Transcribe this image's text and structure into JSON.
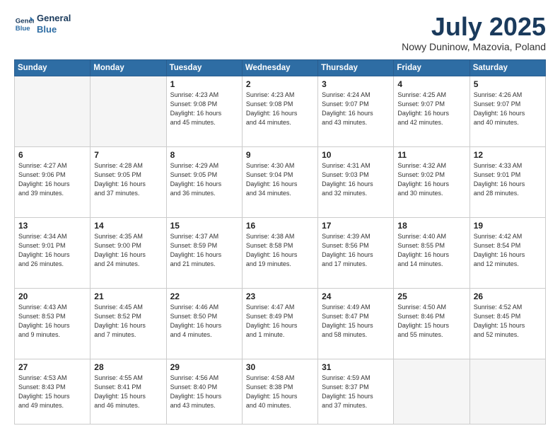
{
  "header": {
    "logo_line1": "General",
    "logo_line2": "Blue",
    "title": "July 2025",
    "subtitle": "Nowy Duninow, Mazovia, Poland"
  },
  "weekdays": [
    "Sunday",
    "Monday",
    "Tuesday",
    "Wednesday",
    "Thursday",
    "Friday",
    "Saturday"
  ],
  "weeks": [
    [
      {
        "day": "",
        "info": ""
      },
      {
        "day": "",
        "info": ""
      },
      {
        "day": "1",
        "info": "Sunrise: 4:23 AM\nSunset: 9:08 PM\nDaylight: 16 hours\nand 45 minutes."
      },
      {
        "day": "2",
        "info": "Sunrise: 4:23 AM\nSunset: 9:08 PM\nDaylight: 16 hours\nand 44 minutes."
      },
      {
        "day": "3",
        "info": "Sunrise: 4:24 AM\nSunset: 9:07 PM\nDaylight: 16 hours\nand 43 minutes."
      },
      {
        "day": "4",
        "info": "Sunrise: 4:25 AM\nSunset: 9:07 PM\nDaylight: 16 hours\nand 42 minutes."
      },
      {
        "day": "5",
        "info": "Sunrise: 4:26 AM\nSunset: 9:07 PM\nDaylight: 16 hours\nand 40 minutes."
      }
    ],
    [
      {
        "day": "6",
        "info": "Sunrise: 4:27 AM\nSunset: 9:06 PM\nDaylight: 16 hours\nand 39 minutes."
      },
      {
        "day": "7",
        "info": "Sunrise: 4:28 AM\nSunset: 9:05 PM\nDaylight: 16 hours\nand 37 minutes."
      },
      {
        "day": "8",
        "info": "Sunrise: 4:29 AM\nSunset: 9:05 PM\nDaylight: 16 hours\nand 36 minutes."
      },
      {
        "day": "9",
        "info": "Sunrise: 4:30 AM\nSunset: 9:04 PM\nDaylight: 16 hours\nand 34 minutes."
      },
      {
        "day": "10",
        "info": "Sunrise: 4:31 AM\nSunset: 9:03 PM\nDaylight: 16 hours\nand 32 minutes."
      },
      {
        "day": "11",
        "info": "Sunrise: 4:32 AM\nSunset: 9:02 PM\nDaylight: 16 hours\nand 30 minutes."
      },
      {
        "day": "12",
        "info": "Sunrise: 4:33 AM\nSunset: 9:01 PM\nDaylight: 16 hours\nand 28 minutes."
      }
    ],
    [
      {
        "day": "13",
        "info": "Sunrise: 4:34 AM\nSunset: 9:01 PM\nDaylight: 16 hours\nand 26 minutes."
      },
      {
        "day": "14",
        "info": "Sunrise: 4:35 AM\nSunset: 9:00 PM\nDaylight: 16 hours\nand 24 minutes."
      },
      {
        "day": "15",
        "info": "Sunrise: 4:37 AM\nSunset: 8:59 PM\nDaylight: 16 hours\nand 21 minutes."
      },
      {
        "day": "16",
        "info": "Sunrise: 4:38 AM\nSunset: 8:58 PM\nDaylight: 16 hours\nand 19 minutes."
      },
      {
        "day": "17",
        "info": "Sunrise: 4:39 AM\nSunset: 8:56 PM\nDaylight: 16 hours\nand 17 minutes."
      },
      {
        "day": "18",
        "info": "Sunrise: 4:40 AM\nSunset: 8:55 PM\nDaylight: 16 hours\nand 14 minutes."
      },
      {
        "day": "19",
        "info": "Sunrise: 4:42 AM\nSunset: 8:54 PM\nDaylight: 16 hours\nand 12 minutes."
      }
    ],
    [
      {
        "day": "20",
        "info": "Sunrise: 4:43 AM\nSunset: 8:53 PM\nDaylight: 16 hours\nand 9 minutes."
      },
      {
        "day": "21",
        "info": "Sunrise: 4:45 AM\nSunset: 8:52 PM\nDaylight: 16 hours\nand 7 minutes."
      },
      {
        "day": "22",
        "info": "Sunrise: 4:46 AM\nSunset: 8:50 PM\nDaylight: 16 hours\nand 4 minutes."
      },
      {
        "day": "23",
        "info": "Sunrise: 4:47 AM\nSunset: 8:49 PM\nDaylight: 16 hours\nand 1 minute."
      },
      {
        "day": "24",
        "info": "Sunrise: 4:49 AM\nSunset: 8:47 PM\nDaylight: 15 hours\nand 58 minutes."
      },
      {
        "day": "25",
        "info": "Sunrise: 4:50 AM\nSunset: 8:46 PM\nDaylight: 15 hours\nand 55 minutes."
      },
      {
        "day": "26",
        "info": "Sunrise: 4:52 AM\nSunset: 8:45 PM\nDaylight: 15 hours\nand 52 minutes."
      }
    ],
    [
      {
        "day": "27",
        "info": "Sunrise: 4:53 AM\nSunset: 8:43 PM\nDaylight: 15 hours\nand 49 minutes."
      },
      {
        "day": "28",
        "info": "Sunrise: 4:55 AM\nSunset: 8:41 PM\nDaylight: 15 hours\nand 46 minutes."
      },
      {
        "day": "29",
        "info": "Sunrise: 4:56 AM\nSunset: 8:40 PM\nDaylight: 15 hours\nand 43 minutes."
      },
      {
        "day": "30",
        "info": "Sunrise: 4:58 AM\nSunset: 8:38 PM\nDaylight: 15 hours\nand 40 minutes."
      },
      {
        "day": "31",
        "info": "Sunrise: 4:59 AM\nSunset: 8:37 PM\nDaylight: 15 hours\nand 37 minutes."
      },
      {
        "day": "",
        "info": ""
      },
      {
        "day": "",
        "info": ""
      }
    ]
  ]
}
